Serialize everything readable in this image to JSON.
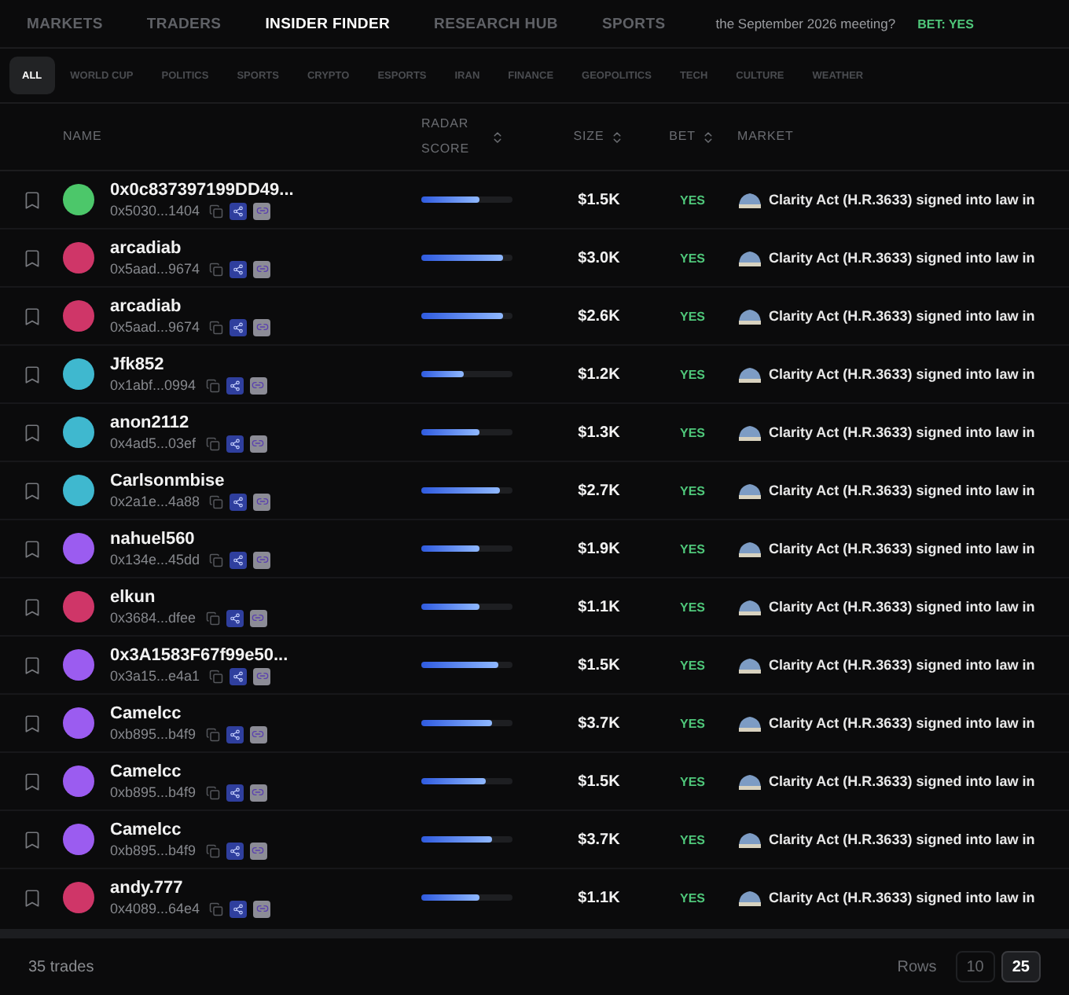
{
  "nav": {
    "tabs": [
      {
        "label": "MARKETS",
        "selected": false
      },
      {
        "label": "TRADERS",
        "selected": false
      },
      {
        "label": "INSIDER FINDER",
        "selected": true
      },
      {
        "label": "RESEARCH HUB",
        "selected": false
      },
      {
        "label": "SPORTS",
        "selected": false
      }
    ],
    "ticker": {
      "question": "the September 2026 meeting?",
      "bet": "BET: YES"
    }
  },
  "filters": [
    {
      "label": "ALL",
      "selected": true
    },
    {
      "label": "WORLD CUP",
      "selected": false
    },
    {
      "label": "POLITICS",
      "selected": false
    },
    {
      "label": "SPORTS",
      "selected": false
    },
    {
      "label": "CRYPTO",
      "selected": false
    },
    {
      "label": "ESPORTS",
      "selected": false
    },
    {
      "label": "IRAN",
      "selected": false
    },
    {
      "label": "FINANCE",
      "selected": false
    },
    {
      "label": "GEOPOLITICS",
      "selected": false
    },
    {
      "label": "TECH",
      "selected": false
    },
    {
      "label": "CULTURE",
      "selected": false
    },
    {
      "label": "WEATHER",
      "selected": false
    }
  ],
  "table": {
    "columns": [
      {
        "label": "NAME",
        "sortable": false
      },
      {
        "label": "RADAR SCORE",
        "sortable": true
      },
      {
        "label": "SIZE",
        "sortable": true
      },
      {
        "label": "BET",
        "sortable": true
      },
      {
        "label": "MARKET",
        "sortable": false
      }
    ],
    "rows": [
      {
        "name": "0x0c837397199DD49...",
        "wallet": "0x5030...1404",
        "color": "#4cc76a",
        "level": 0.64,
        "size": "$1.5K",
        "bet": "YES",
        "market": "Clarity Act (H.R.3633) signed into law in"
      },
      {
        "name": "arcadiab",
        "wallet": "0x5aad...9674",
        "color": "#cf3668",
        "level": 0.89,
        "size": "$3.0K",
        "bet": "YES",
        "market": "Clarity Act (H.R.3633) signed into law in"
      },
      {
        "name": "arcadiab",
        "wallet": "0x5aad...9674",
        "color": "#cf3668",
        "level": 0.89,
        "size": "$2.6K",
        "bet": "YES",
        "market": "Clarity Act (H.R.3633) signed into law in"
      },
      {
        "name": "Jfk852",
        "wallet": "0x1abf...0994",
        "color": "#3fb8cf",
        "level": 0.47,
        "size": "$1.2K",
        "bet": "YES",
        "market": "Clarity Act (H.R.3633) signed into law in"
      },
      {
        "name": "anon2112",
        "wallet": "0x4ad5...03ef",
        "color": "#3fb8cf",
        "level": 0.64,
        "size": "$1.3K",
        "bet": "YES",
        "market": "Clarity Act (H.R.3633) signed into law in"
      },
      {
        "name": "Carlsonmbise",
        "wallet": "0x2a1e...4a88",
        "color": "#3fb8cf",
        "level": 0.86,
        "size": "$2.7K",
        "bet": "YES",
        "market": "Clarity Act (H.R.3633) signed into law in"
      },
      {
        "name": "nahuel560",
        "wallet": "0x134e...45dd",
        "color": "#9b5cf0",
        "level": 0.64,
        "size": "$1.9K",
        "bet": "YES",
        "market": "Clarity Act (H.R.3633) signed into law in"
      },
      {
        "name": "elkun",
        "wallet": "0x3684...dfee",
        "color": "#cf3668",
        "level": 0.64,
        "size": "$1.1K",
        "bet": "YES",
        "market": "Clarity Act (H.R.3633) signed into law in"
      },
      {
        "name": "0x3A1583F67f99e50...",
        "wallet": "0x3a15...e4a1",
        "color": "#9b5cf0",
        "level": 0.85,
        "size": "$1.5K",
        "bet": "YES",
        "market": "Clarity Act (H.R.3633) signed into law in"
      },
      {
        "name": "Camelcc",
        "wallet": "0xb895...b4f9",
        "color": "#9b5cf0",
        "level": 0.77,
        "size": "$3.7K",
        "bet": "YES",
        "market": "Clarity Act (H.R.3633) signed into law in"
      },
      {
        "name": "Camelcc",
        "wallet": "0xb895...b4f9",
        "color": "#9b5cf0",
        "level": 0.7,
        "size": "$1.5K",
        "bet": "YES",
        "market": "Clarity Act (H.R.3633) signed into law in"
      },
      {
        "name": "Camelcc",
        "wallet": "0xb895...b4f9",
        "color": "#9b5cf0",
        "level": 0.77,
        "size": "$3.7K",
        "bet": "YES",
        "market": "Clarity Act (H.R.3633) signed into law in"
      },
      {
        "name": "andy.777",
        "wallet": "0x4089...64e4",
        "color": "#cf3668",
        "level": 0.64,
        "size": "$1.1K",
        "bet": "YES",
        "market": "Clarity Act (H.R.3633) signed into law in"
      }
    ]
  },
  "footer": {
    "count": "35 trades",
    "rows_label": "Rows",
    "page_sizes": [
      {
        "label": "10",
        "selected": false
      },
      {
        "label": "25",
        "selected": true
      }
    ]
  }
}
